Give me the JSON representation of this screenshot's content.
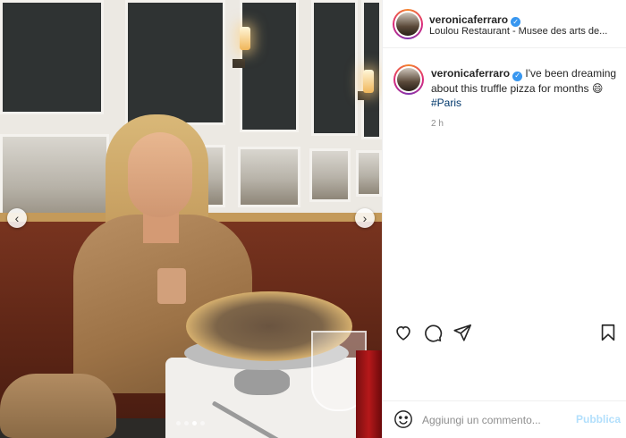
{
  "post": {
    "username": "veronicaferraro",
    "location": "Loulou Restaurant - Musee des arts de...",
    "caption_text": "I've been dreaming about this truffle pizza for months",
    "caption_emoji": "😄",
    "hashtag": "#Paris",
    "time_ago": "2 h"
  },
  "carousel": {
    "prev_icon": "chevron-left-icon",
    "next_icon": "chevron-right-icon",
    "prev_glyph": "‹",
    "next_glyph": "›",
    "slide_count": 4,
    "active_slide": 3
  },
  "actions": {
    "like_icon": "heart-icon",
    "comment_icon": "comment-bubble-icon",
    "share_icon": "paper-plane-icon",
    "save_icon": "bookmark-icon"
  },
  "comment_box": {
    "placeholder": "Aggiungi un commento...",
    "publish_label": "Pubblica",
    "emoji_icon": "smiley-icon"
  },
  "colors": {
    "verified": "#3897f0",
    "hashtag": "#00376b",
    "publish_disabled": "#b2dffc",
    "muted": "#8e8e8e"
  }
}
